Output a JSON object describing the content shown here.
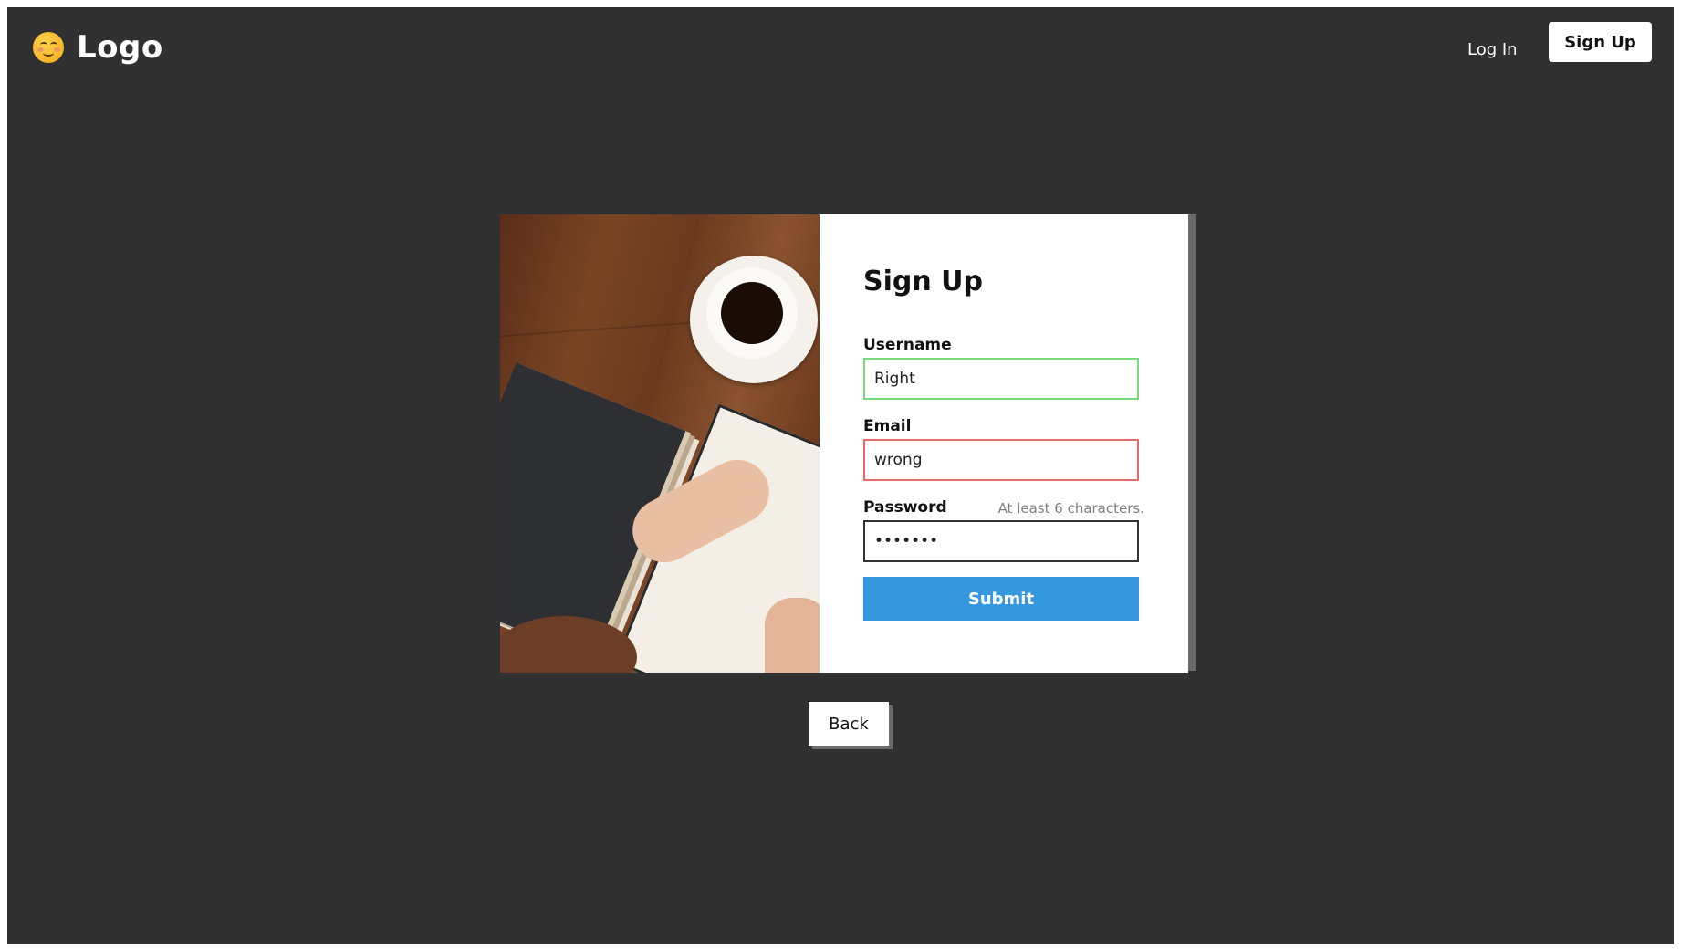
{
  "header": {
    "logo_text": "Logo",
    "logo_icon": "smiling-emoji-icon",
    "login_label": "Log In",
    "signup_label": "Sign Up"
  },
  "form": {
    "title": "Sign Up",
    "username": {
      "label": "Username",
      "value": "Right",
      "state": "valid"
    },
    "email": {
      "label": "Email",
      "value": "wrong",
      "state": "invalid"
    },
    "password": {
      "label": "Password",
      "hint": "At least 6 characters.",
      "value": "1234567"
    },
    "submit_label": "Submit"
  },
  "back_label": "Back",
  "colors": {
    "background": "#303030",
    "valid_border": "#7ad97a",
    "invalid_border": "#e86a6a",
    "submit": "#3597de"
  }
}
